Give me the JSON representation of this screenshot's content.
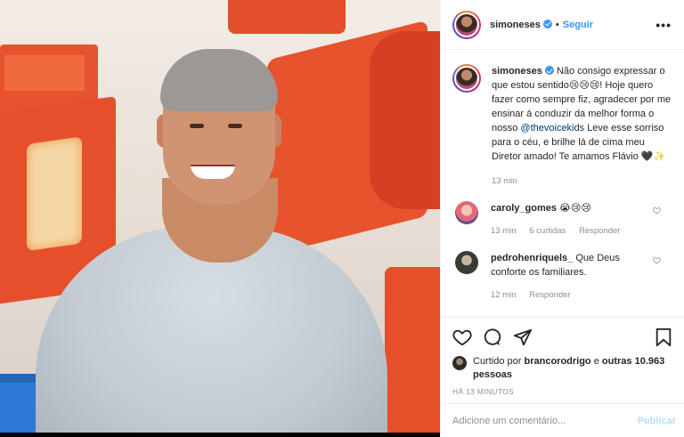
{
  "header": {
    "username": "simoneses",
    "dot": "•",
    "follow_label": "Seguir",
    "more_label": "•••"
  },
  "caption": {
    "username": "simoneses",
    "text_before_mention": "Não consigo expressar o que estou sentido😢😢😢! Hoje quero fazer como sempre fiz, agradecer por me ensinar á conduzir da melhor forma o nosso",
    "mention": "@thevoicekids",
    "text_after_mention": "Leve esse sorriso para o céu, e brilhe lá de cima meu Diretor amado! Te amamos Flávio 🖤✨",
    "time": "13 min"
  },
  "comments": [
    {
      "username": "caroly_gomes",
      "text": "😭😢😢",
      "time": "13 min",
      "likes": "6 curtidas",
      "reply_label": "Responder"
    },
    {
      "username": "pedrohenriquels_",
      "text": "Que Deus conforte os familiares.",
      "time": "12 min",
      "reply_label": "Responder"
    }
  ],
  "likes": {
    "prefix": "Curtido por",
    "user": "brancorodrigo",
    "connector": "e",
    "others": "outras 10.963 pessoas"
  },
  "timestamp": "HÁ 13 MINUTOS",
  "add_comment": {
    "placeholder": "Adicione um comentário...",
    "publish_label": "Publicar"
  },
  "colors": {
    "accent": "#3897f0",
    "mention": "#00376b",
    "muted": "#8e8e8e",
    "publish_disabled": "#b2dffc"
  },
  "icons": [
    "verified-badge-icon",
    "heart-icon",
    "comment-icon",
    "share-icon",
    "bookmark-icon",
    "more-icon"
  ]
}
